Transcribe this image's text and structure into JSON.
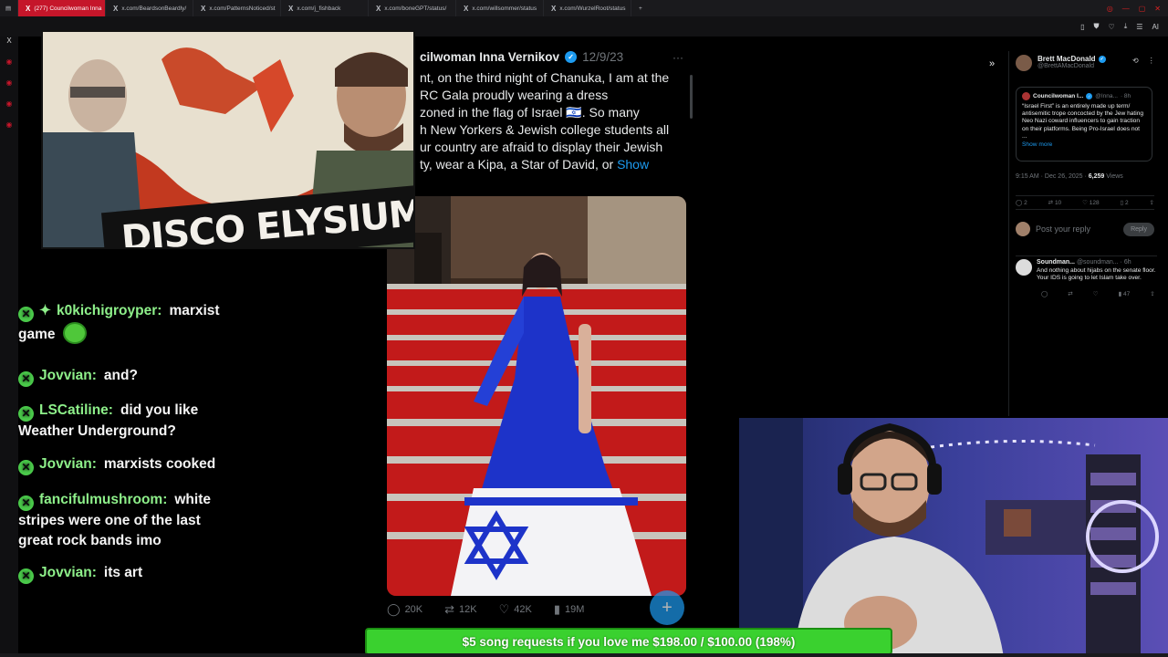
{
  "browser": {
    "tabs": [
      {
        "label": "(277) Councilwoman Inna",
        "active": true
      },
      {
        "label": "x.com/BeardsonBeardly/",
        "active": false
      },
      {
        "label": "x.com/PatternsNoticed/st",
        "active": false
      },
      {
        "label": "x.com/j_fishback",
        "active": false
      },
      {
        "label": "x.com/boneGPT/status/",
        "active": false
      },
      {
        "label": "x.com/willsommer/status",
        "active": false
      },
      {
        "label": "x.com/WurzelRoot/status",
        "active": false
      }
    ],
    "new_tab": "+",
    "toolbar_extra": "AI"
  },
  "tweet": {
    "author": "cilwoman Inna Vernikov",
    "date": "12/9/23",
    "more": "···",
    "text_lines": [
      "nt, on the third night of Chanuka, I am at the",
      "RC Gala proudly wearing a dress",
      "zoned in the flag of Israel 🇮🇱. So many",
      "h New Yorkers & Jewish college students all",
      "ur country are afraid to display their Jewish",
      "ty, wear a Kipa, a Star of David, or"
    ],
    "show_more": "Show",
    "stats": {
      "replies": "20K",
      "reposts": "12K",
      "likes": "42K",
      "views": "19M"
    }
  },
  "side_panel": {
    "author": "Brett MacDonald",
    "handle": "@BrettAMacDonald",
    "quoted": {
      "author": "Councilwoman I...",
      "handle": "@Inna...",
      "age": "· 8h",
      "text": "“Israel First” is an entirely made up term/ antisemitic trope concocted by the Jew hating Neo Nazi coward influencers to gain traction on their platforms. Being Pro-Israel does not ...",
      "show_more": "Show more"
    },
    "timestamp": "9:15 AM · Dec 26, 2025 ·",
    "views": "6,259",
    "views_label": "Views",
    "stats": {
      "replies": "2",
      "reposts": "10",
      "likes": "128",
      "bookmarks": "2"
    },
    "reply_placeholder": "Post your reply",
    "reply_button": "Reply",
    "reply2": {
      "author": "Soundman...",
      "handle": "@soundman...",
      "age": "· 6h",
      "text": "And nothing about hijabs on the senate floor. Your IDS is going to let Islam take over.",
      "views": "47"
    }
  },
  "stream": {
    "game_title": "DISCO ELYSIUM",
    "chat": [
      {
        "user": "k0kichigroyper:",
        "text": "marxist game",
        "emote": true,
        "diamond": true
      },
      {
        "user": "Jovvian:",
        "text": "and?"
      },
      {
        "user": "LSCatiline:",
        "text": "did you like Weather Underground?"
      },
      {
        "user": "Jovvian:",
        "text": "marxists cooked"
      },
      {
        "user": "fancifulmushroom:",
        "text": "white stripes were one of the last great rock bands imo"
      },
      {
        "user": "Jovvian:",
        "text": "its art"
      }
    ],
    "donation_goal": "$5 song requests if you love me $198.00 / $100.00 (198%)"
  },
  "colors": {
    "accent": "#1d9bf0",
    "chat_name": "#8ef08a",
    "goal_bar": "#3ad12f",
    "tab_active": "#c5162a"
  }
}
